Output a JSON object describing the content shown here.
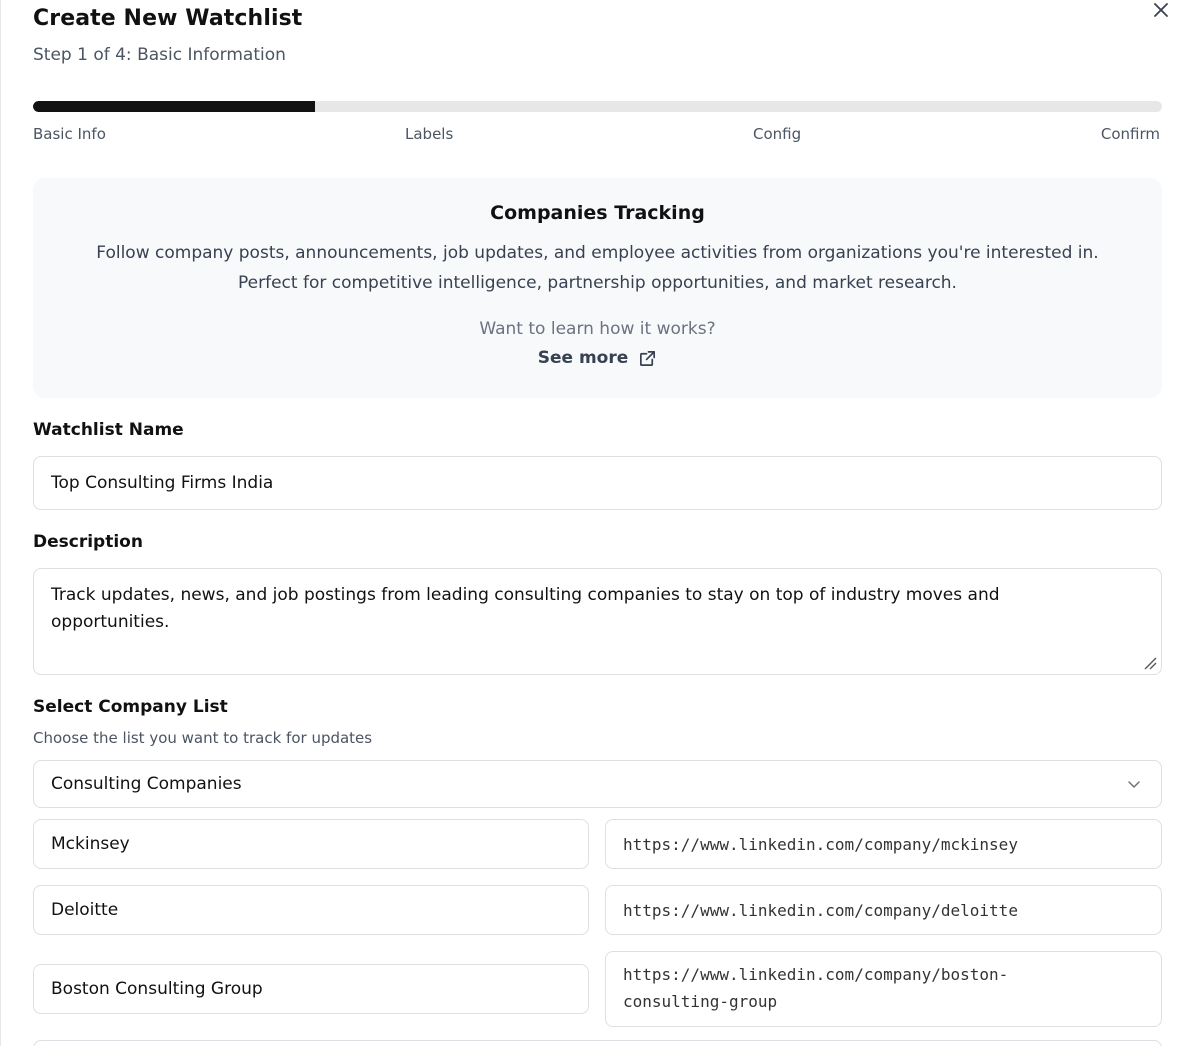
{
  "header": {
    "title": "Create New Watchlist",
    "subtitle": "Step 1 of 4: Basic Information",
    "close_icon": "close-icon"
  },
  "progress": {
    "fraction": 0.25,
    "steps": [
      "Basic Info",
      "Labels",
      "Config",
      "Confirm"
    ]
  },
  "info_box": {
    "title": "Companies Tracking",
    "desc_line1": "Follow company posts, announcements, job updates, and employee activities from organizations you're interested in.",
    "desc_line2": "Perfect for competitive intelligence, partnership opportunities, and market research.",
    "ask": "Want to learn how it works?",
    "see_more": "See more",
    "see_more_icon": "external-link-icon"
  },
  "form": {
    "name_label": "Watchlist Name",
    "name_value": "Top Consulting Firms India",
    "desc_label": "Description",
    "desc_value": "Track updates, news, and job postings from leading consulting companies to stay on top of industry moves and opportunities.",
    "list_label": "Select Company List",
    "list_hint": "Choose the list you want to track for updates",
    "list_value": "Consulting Companies",
    "companies": [
      {
        "name": "Mckinsey",
        "url": "https://www.linkedin.com/company/mckinsey"
      },
      {
        "name": "Deloitte",
        "url": "https://www.linkedin.com/company/deloitte"
      },
      {
        "name": "Boston Consulting Group",
        "url_line1": "https://www.linkedin.com/company/boston-",
        "url_line2": "consulting-group"
      }
    ]
  },
  "colors": {
    "progress_fill": "#121212",
    "progress_track": "#e7e7e7",
    "info_bg": "#f8f9fb",
    "border": "#dcdfe4"
  }
}
